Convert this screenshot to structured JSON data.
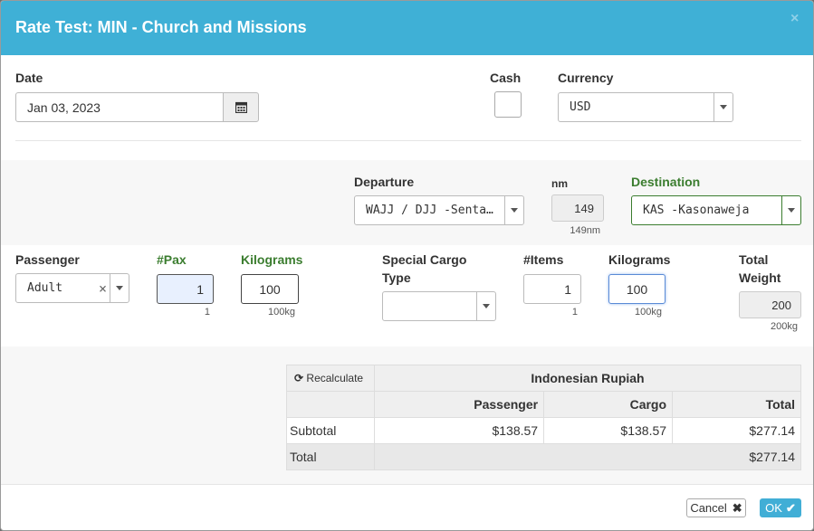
{
  "modal": {
    "title": "Rate Test: MIN - Church and Missions",
    "close": "×"
  },
  "date": {
    "label": "Date",
    "value": "Jan 03, 2023"
  },
  "cash": {
    "label": "Cash"
  },
  "currency": {
    "label": "Currency",
    "value": "USD"
  },
  "departure": {
    "label": "Departure",
    "value": "WAJJ / DJJ -Senta…"
  },
  "nm": {
    "label": "nm",
    "value": "149",
    "hint": "149nm"
  },
  "destination": {
    "label": "Destination",
    "value": "KAS -Kasonaweja"
  },
  "passenger": {
    "label": "Passenger",
    "value": "Adult",
    "clear": "×"
  },
  "pax": {
    "label": "#Pax",
    "value": "1",
    "hint": "1"
  },
  "pax_kg": {
    "label": "Kilograms",
    "value": "100",
    "hint": "100kg"
  },
  "cargo_type": {
    "label_line1": "Special Cargo",
    "label_line2": "Type",
    "value": ""
  },
  "items": {
    "label": "#Items",
    "value": "1",
    "hint": "1"
  },
  "cargo_kg": {
    "label": "Kilograms",
    "value": "100",
    "hint": "100kg"
  },
  "total_weight": {
    "label_line1": "Total",
    "label_line2": "Weight",
    "value": "200",
    "hint": "200kg"
  },
  "rates": {
    "recalculate": "Recalculate",
    "currency_header": "Indonesian Rupiah",
    "col_passenger": "Passenger",
    "col_cargo": "Cargo",
    "col_total": "Total",
    "subtotal_label": "Subtotal",
    "subtotal_passenger": "$138.57",
    "subtotal_cargo": "$138.57",
    "subtotal_total": "$277.14",
    "total_label": "Total",
    "total_value": "$277.14"
  },
  "footer": {
    "cancel": "Cancel",
    "ok": "OK"
  },
  "colors": {
    "header": "#3fb0d6",
    "green_label": "#3b7d2f",
    "ok_button": "#41aed6"
  }
}
